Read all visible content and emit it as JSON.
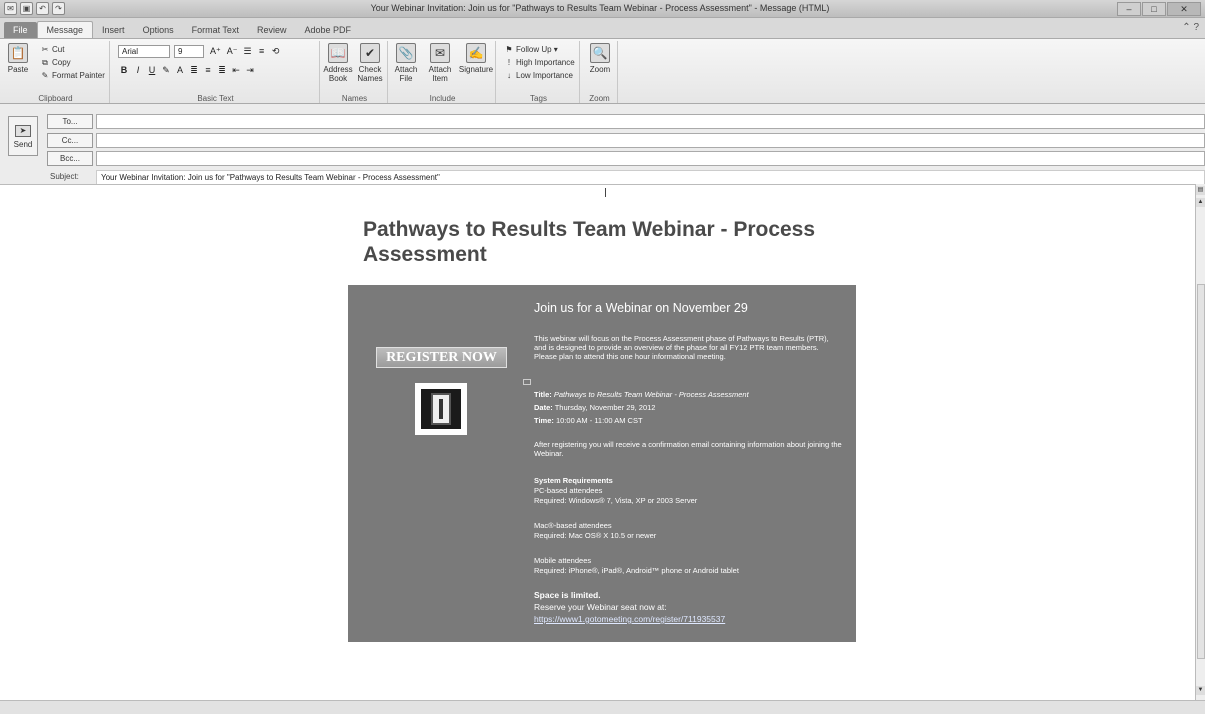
{
  "window": {
    "title": "Your Webinar Invitation: Join us for \"Pathways to Results Team Webinar - Process Assessment\" - Message (HTML)"
  },
  "tabs": [
    "File",
    "Message",
    "Insert",
    "Options",
    "Format Text",
    "Review",
    "Adobe PDF"
  ],
  "ribbon": {
    "clipboard": {
      "paste": "Paste",
      "cut": "Cut",
      "copy": "Copy",
      "format_painter": "Format Painter",
      "label": "Clipboard"
    },
    "basic_text": {
      "font": "Arial",
      "size": "9",
      "label": "Basic Text"
    },
    "names": {
      "address_book": "Address Book",
      "check_names": "Check Names",
      "label": "Names"
    },
    "include": {
      "attach_file": "Attach File",
      "attach_item": "Attach Item",
      "signature": "Signature",
      "label": "Include"
    },
    "tags": {
      "follow_up": "Follow Up",
      "high": "High Importance",
      "low": "Low Importance",
      "label": "Tags"
    },
    "zoom": {
      "zoom": "Zoom",
      "label": "Zoom"
    }
  },
  "header": {
    "send": "Send",
    "to": "To...",
    "cc": "Cc...",
    "bcc": "Bcc...",
    "subject_label": "Subject:",
    "subject_value": "Your Webinar Invitation: Join us for \"Pathways to Results Team Webinar - Process Assessment\""
  },
  "email": {
    "heading": "Pathways to Results Team Webinar - Process Assessment",
    "register_button": "REGISTER NOW",
    "panel_title": "Join us for a Webinar on November 29",
    "intro": "This webinar will focus on the Process Assessment phase of Pathways to Results (PTR), and is designed to provide an overview of the phase for all FY12 PTR team members.  Please plan to attend this one hour informational meeting.",
    "title_label": "Title:",
    "title_value": "Pathways to Results Team Webinar - Process Assessment",
    "date_label": "Date:",
    "date_value": "Thursday, November 29, 2012",
    "time_label": "Time:",
    "time_value": "10:00 AM - 11:00 AM CST",
    "after_register": "After registering you will receive a confirmation email containing information about joining the Webinar.",
    "sysreq_heading": "System Requirements",
    "pc_label": "PC-based attendees",
    "pc_req": "Required: Windows® 7, Vista, XP or 2003 Server",
    "mac_label": "Mac®-based attendees",
    "mac_req": "Required: Mac OS® X 10.5 or newer",
    "mobile_label": "Mobile attendees",
    "mobile_req": "Required: iPhone®, iPad®, Android™ phone or Android tablet",
    "space_limited": "Space is limited.",
    "reserve": "Reserve your Webinar seat now at:",
    "link": "https://www1.gotomeeting.com/register/711935537"
  }
}
